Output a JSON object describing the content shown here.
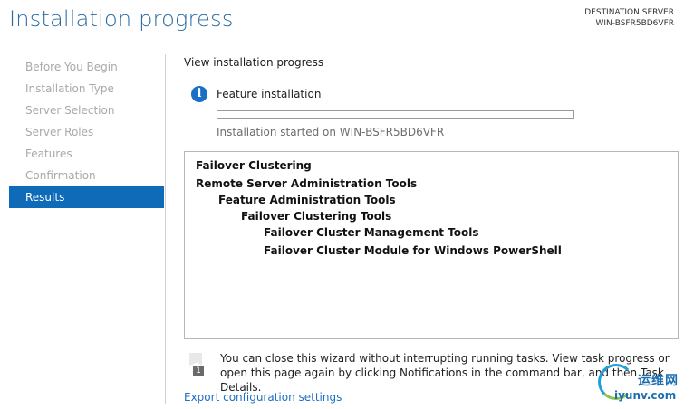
{
  "header": {
    "title": "Installation progress",
    "destination_label": "DESTINATION SERVER",
    "destination_server": "WIN-BSFR5BD6VFR"
  },
  "sidebar": {
    "items": [
      {
        "label": "Before You Begin",
        "active": false
      },
      {
        "label": "Installation Type",
        "active": false
      },
      {
        "label": "Server Selection",
        "active": false
      },
      {
        "label": "Server Roles",
        "active": false
      },
      {
        "label": "Features",
        "active": false
      },
      {
        "label": "Confirmation",
        "active": false
      },
      {
        "label": "Results",
        "active": true
      }
    ]
  },
  "main": {
    "subheading": "View installation progress",
    "status": {
      "icon": "info-icon",
      "label": "Feature installation",
      "progress_fraction": 0.0,
      "started_text": "Installation started on WIN-BSFR5BD6VFR"
    },
    "results": [
      "Failover Clustering",
      "Remote Server Administration Tools",
      "Feature Administration Tools",
      "Failover Clustering Tools",
      "Failover Cluster Management Tools",
      "Failover Cluster Module for Windows PowerShell"
    ],
    "note": {
      "icon": "notification-flag-icon",
      "badge": "1",
      "text": "You can close this wizard without interrupting running tasks. View task progress or open this page again by clicking Notifications in the command bar, and then Task Details."
    },
    "export_link": "Export configuration settings"
  },
  "watermark": {
    "cn": "运维网",
    "en": "iyunv.com"
  },
  "colors": {
    "title": "#2b6aa3",
    "nav_active_bg": "#0f6ab8",
    "link": "#1e6fc1",
    "info_icon": "#1a6fc7"
  }
}
